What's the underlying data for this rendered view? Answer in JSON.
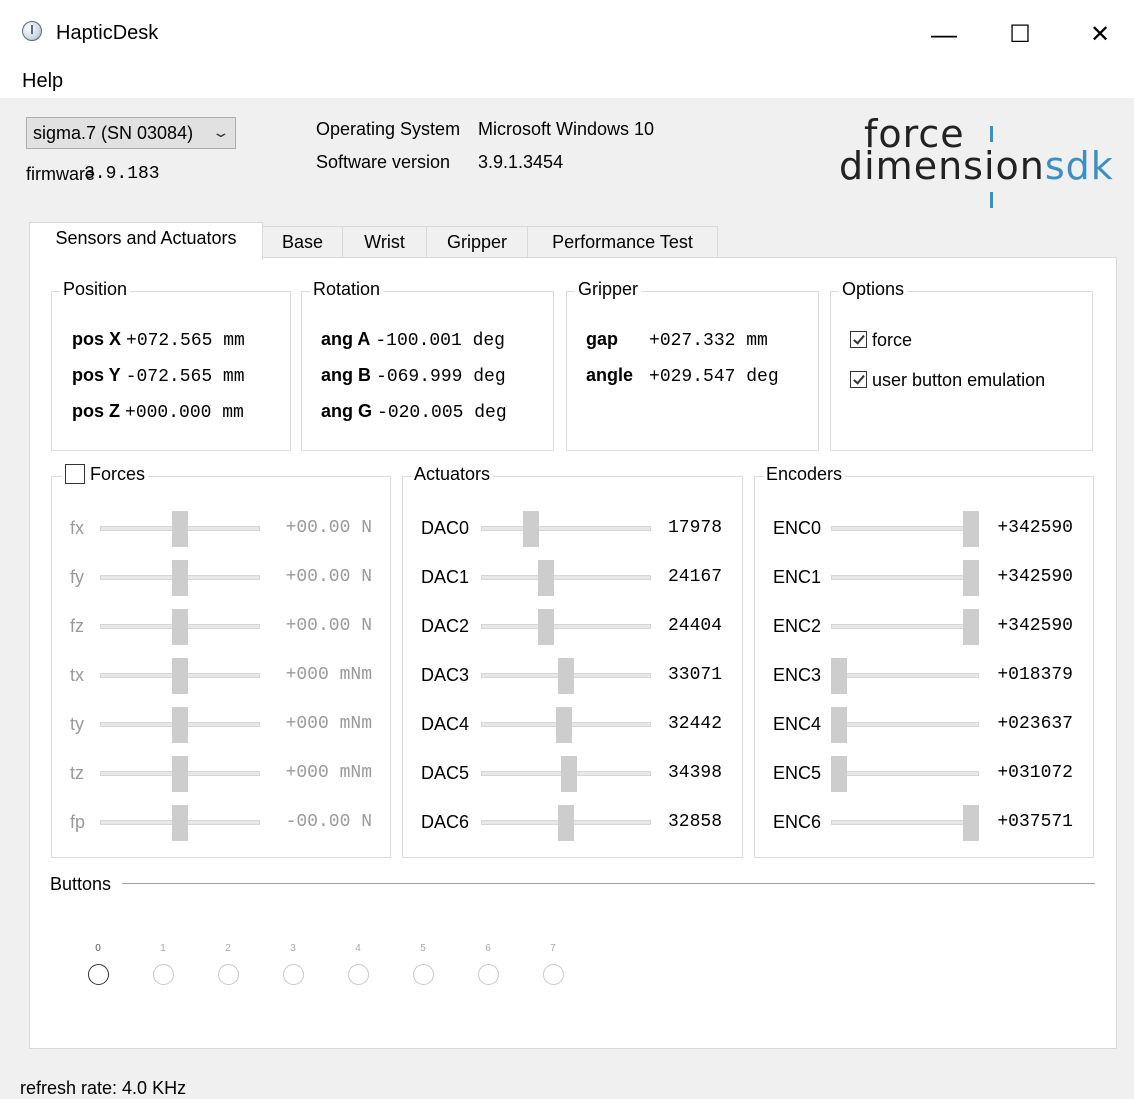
{
  "window": {
    "title": "HapticDesk",
    "minimize": "—",
    "maximize": "☐",
    "close": "✕"
  },
  "menu": {
    "help": "Help"
  },
  "device": {
    "selected": "sigma.7 (SN 03084)",
    "firmware_label": "firmware",
    "firmware_value": "3.9.183"
  },
  "info": {
    "os_label": "Operating System",
    "os_value": "Microsoft Windows 10",
    "sw_label": "Software version",
    "sw_value": "3.9.1.3454"
  },
  "logo": {
    "line1": "force",
    "line2a": "dimension",
    "line2b": "sdk"
  },
  "tabs": [
    {
      "label": "Sensors and Actuators"
    },
    {
      "label": "Base"
    },
    {
      "label": "Wrist"
    },
    {
      "label": "Gripper"
    },
    {
      "label": "Performance Test"
    }
  ],
  "position": {
    "title": "Position",
    "rows": [
      {
        "label": "pos X",
        "value": "+072.565 mm"
      },
      {
        "label": "pos Y",
        "value": "-072.565 mm"
      },
      {
        "label": "pos Z",
        "value": "+000.000 mm"
      }
    ]
  },
  "rotation": {
    "title": "Rotation",
    "rows": [
      {
        "label": "ang A",
        "value": "-100.001 deg"
      },
      {
        "label": "ang B",
        "value": "-069.999 deg"
      },
      {
        "label": "ang G",
        "value": "-020.005 deg"
      }
    ]
  },
  "gripper": {
    "title": "Gripper",
    "rows": [
      {
        "label": "gap",
        "value": "+027.332 mm"
      },
      {
        "label": "angle",
        "value": "+029.547 deg"
      }
    ]
  },
  "options": {
    "title": "Options",
    "items": [
      {
        "label": "force",
        "checked": true
      },
      {
        "label": "user button emulation",
        "checked": true
      }
    ]
  },
  "forces": {
    "title": "Forces",
    "enabled": false,
    "sliders": [
      {
        "label": "fx",
        "value": "+00.00 N",
        "level": 0.5
      },
      {
        "label": "fy",
        "value": "+00.00 N",
        "level": 0.5
      },
      {
        "label": "fz",
        "value": "+00.00 N",
        "level": 0.5
      },
      {
        "label": "tx",
        "value": "+000 mNm",
        "level": 0.5
      },
      {
        "label": "ty",
        "value": "+000 mNm",
        "level": 0.5
      },
      {
        "label": "tz",
        "value": "+000 mNm",
        "level": 0.5
      },
      {
        "label": "fp",
        "value": "-00.00 N",
        "level": 0.5
      }
    ]
  },
  "actuators": {
    "title": "Actuators",
    "sliders": [
      {
        "label": "DAC0",
        "value": "17978",
        "level": 0.27
      },
      {
        "label": "DAC1",
        "value": "24167",
        "level": 0.37
      },
      {
        "label": "DAC2",
        "value": "24404",
        "level": 0.37
      },
      {
        "label": "DAC3",
        "value": "33071",
        "level": 0.5
      },
      {
        "label": "DAC4",
        "value": "32442",
        "level": 0.49
      },
      {
        "label": "DAC5",
        "value": "34398",
        "level": 0.52
      },
      {
        "label": "DAC6",
        "value": "32858",
        "level": 0.5
      }
    ]
  },
  "encoders": {
    "title": "Encoders",
    "sliders": [
      {
        "label": "ENC0",
        "value": "+342590",
        "level": 1.0
      },
      {
        "label": "ENC1",
        "value": "+342590",
        "level": 1.0
      },
      {
        "label": "ENC2",
        "value": "+342590",
        "level": 1.0
      },
      {
        "label": "ENC3",
        "value": "+018379",
        "level": 0.0
      },
      {
        "label": "ENC4",
        "value": "+023637",
        "level": 0.0
      },
      {
        "label": "ENC5",
        "value": "+031072",
        "level": 0.0
      },
      {
        "label": "ENC6",
        "value": "+037571",
        "level": 1.0
      }
    ]
  },
  "buttons": {
    "title": "Buttons",
    "items": [
      {
        "label": "0",
        "enabled": true
      },
      {
        "label": "1",
        "enabled": false
      },
      {
        "label": "2",
        "enabled": false
      },
      {
        "label": "3",
        "enabled": false
      },
      {
        "label": "4",
        "enabled": false
      },
      {
        "label": "5",
        "enabled": false
      },
      {
        "label": "6",
        "enabled": false
      },
      {
        "label": "7",
        "enabled": false
      }
    ]
  },
  "status": {
    "refresh_rate": "refresh rate: 4.0 KHz"
  }
}
